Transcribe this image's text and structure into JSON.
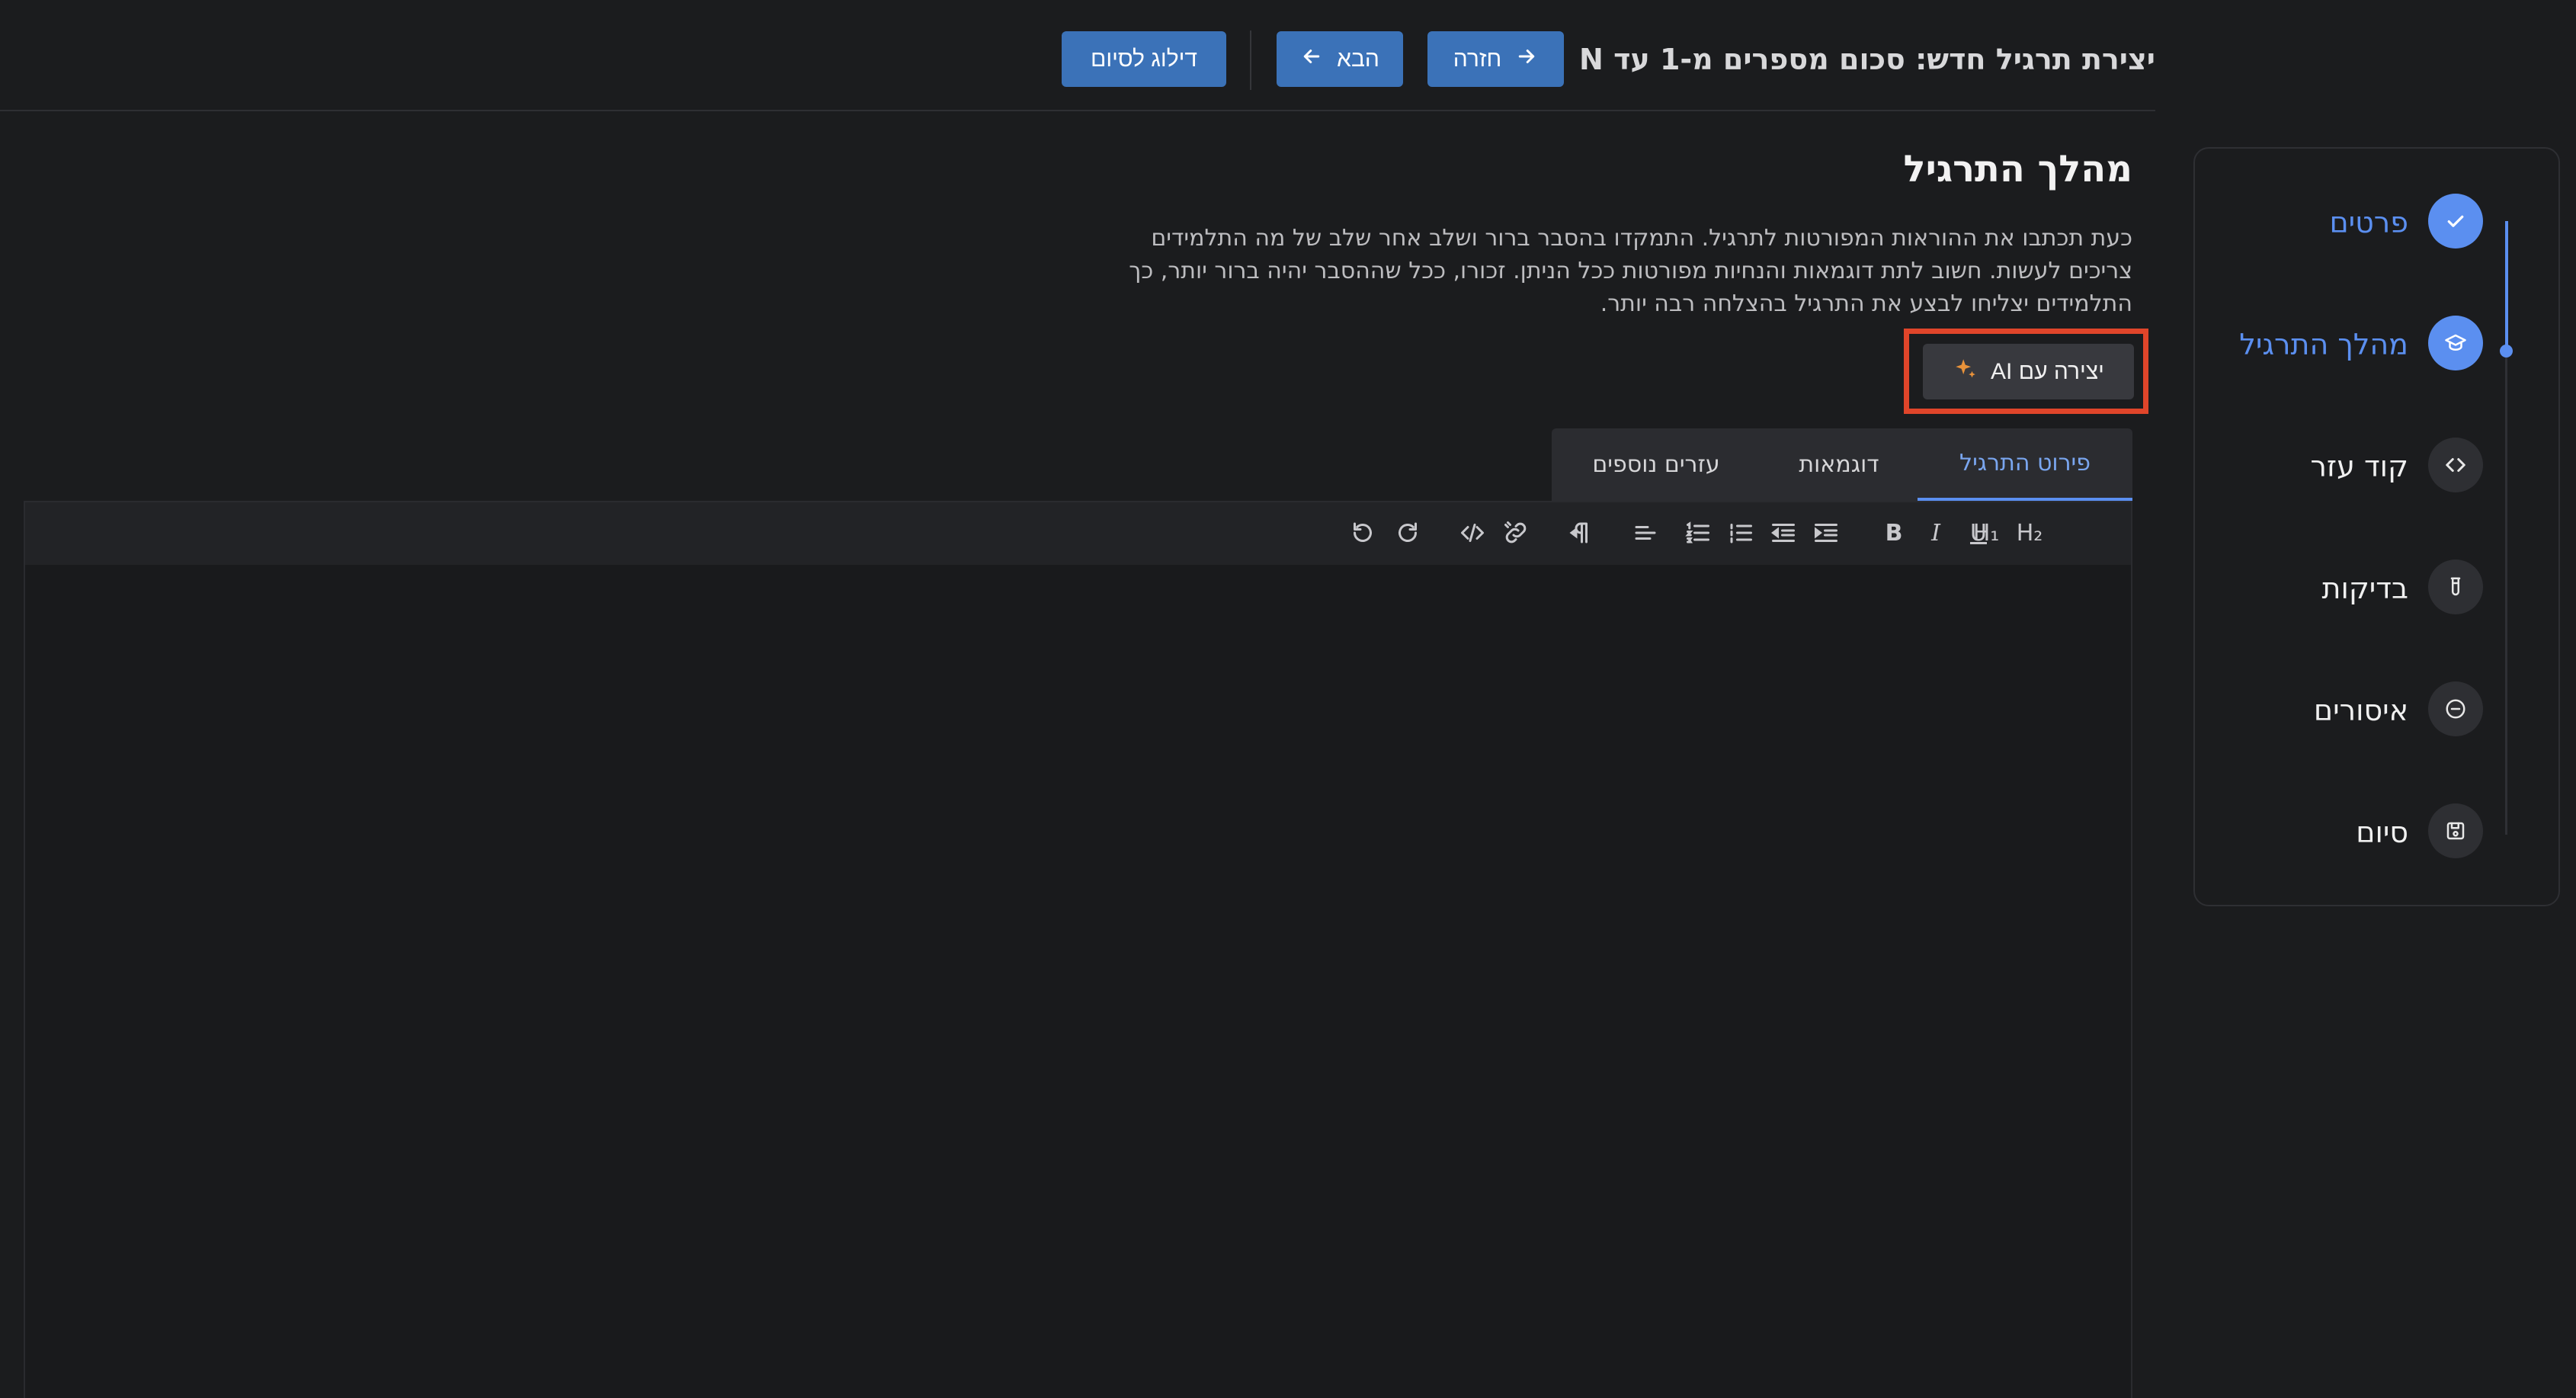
{
  "header": {
    "title": "יצירת תרגיל חדש: סכום מספרים מ-1 עד N",
    "back_label": "חזרה",
    "next_label": "הבא",
    "skip_label": "דילוג לסיום"
  },
  "steps": [
    {
      "label": "פרטים",
      "icon": "check-icon",
      "state": "done"
    },
    {
      "label": "מהלך התרגיל",
      "icon": "graduation-cap-icon",
      "state": "current"
    },
    {
      "label": "קוד עזר",
      "icon": "code-icon",
      "state": "pending"
    },
    {
      "label": "בדיקות",
      "icon": "test-tube-icon",
      "state": "pending"
    },
    {
      "label": "איסורים",
      "icon": "minus-circle-icon",
      "state": "pending"
    },
    {
      "label": "סיום",
      "icon": "save-icon",
      "state": "pending"
    }
  ],
  "main": {
    "title": "מהלך התרגיל",
    "description": "כעת תכתבו את ההוראות המפורטות לתרגיל. התמקדו בהסבר ברור ושלב אחר שלב של מה התלמידים צריכים לעשות. חשוב לתת דוגמאות והנחיות מפורטות ככל הניתן. זכורו, ככל שההסבר יהיה ברור יותר, כך התלמידים יצליחו לבצע את התרגיל בהצלחה רבה יותר.",
    "ai_button_label": "יצירה עם AI"
  },
  "tabs": [
    {
      "label": "פירוט התרגיל",
      "active": true
    },
    {
      "label": "דוגמאות",
      "active": false
    },
    {
      "label": "עזרים נוספים",
      "active": false
    }
  ],
  "toolbar": {
    "h1": "H₁",
    "h2": "H₂",
    "bold": "B",
    "italic": "I",
    "underline": "U"
  },
  "colors": {
    "accent": "#5b8ff0",
    "button": "#3b72b8",
    "highlight": "#e0452a",
    "sparkle": "#e8923a"
  }
}
